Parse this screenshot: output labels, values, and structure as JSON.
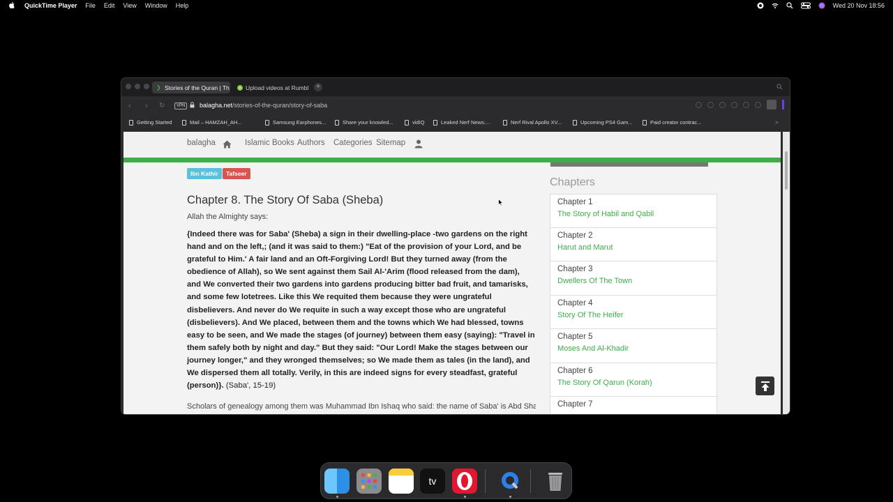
{
  "menubar": {
    "app_name": "QuickTime Player",
    "menus": [
      "File",
      "Edit",
      "View",
      "Window",
      "Help"
    ],
    "datetime": "Wed 20 Nov  18:56"
  },
  "browser": {
    "tabs": [
      {
        "title": "Stories of the Quran | Th",
        "active": true
      },
      {
        "title": "Upload videos at Rumble",
        "active": false
      }
    ],
    "url_domain": "balagha.net",
    "url_path": "/stories-of-the-quran/story-of-saba",
    "vpn_label": "VPN",
    "bookmarks": [
      "Getting Started",
      "Mail – HAMZAH_AH...",
      "Samsung Earphones...",
      "Share your knowled...",
      "vidIQ",
      "Leaked Nerf News:...",
      "Nerf Rival Apollo XV...",
      "Upcoming PS4 Gam...",
      "Paid creator contrac..."
    ]
  },
  "site": {
    "nav": {
      "brand": "balagha",
      "books": "Islamic Books",
      "authors": "Authors",
      "categories": "Categories",
      "sitemap": "Sitemap"
    },
    "tags": [
      "Ibn Kathir",
      "Tafseer"
    ],
    "chapter_title": "Chapter 8. The Story Of Saba (Sheba)",
    "intro": "Allah the Almighty says:",
    "verse_text": "{Indeed there was for Saba' (Sheba) a sign in their dwelling-place -two gardens on the right hand and on the left,; (and it was said to them:) \"Eat of the provision of your Lord, and be grateful to Him.' A fair land and an Oft-Forgiving Lord! But they turned away (from the obedience of Allah), so We sent against them Sail Al-'Arim (flood released from the dam), and We converted their two gardens into gardens producing bitter bad fruit, and tamarisks, and some few lotetrees. Like this We requited them because they were ungrateful disbelievers. And never do We requite in such a way except those who are ungrateful (disbelievers). And We placed, between them and the towns which We had blessed, towns easy to be seen, and We made the stages (of journey) between them easy (saying): \"Travel in them safely both by night and day.\" But they said: \"Our Lord! Make the stages between our journey longer,\" and they wronged themselves; so We made them as tales (in the land), and We dispersed them all totally. Verily, in this are indeed signs for every steadfast, grateful (person)}.",
    "verse_ref": "(Saba', 15-19)",
    "paragraph": "Scholars of genealogy among them was Muhammad Ibn Ishaq who said: the name of Saba' is Abd Shams Ibn Yashjub Ibn",
    "chapters_heading": "Chapters",
    "chapters": [
      {
        "number": "Chapter 1",
        "title": "The Story of Habil and Qabil"
      },
      {
        "number": "Chapter 2",
        "title": "Harut and Marut"
      },
      {
        "number": "Chapter 3",
        "title": "Dwellers Of The Town"
      },
      {
        "number": "Chapter 4",
        "title": "Story Of The Heifer"
      },
      {
        "number": "Chapter 5",
        "title": "Moses And Al-Khadir"
      },
      {
        "number": "Chapter 6",
        "title": "The Story Of Qarun (Korah)"
      },
      {
        "number": "Chapter 7",
        "title": ""
      }
    ]
  },
  "colors": {
    "accent_green": "#3fae49",
    "tag_blue": "#5bc0de",
    "tag_red": "#d9534f"
  },
  "dock": [
    "Finder",
    "Launchpad",
    "Notes",
    "TV",
    "Opera",
    "QuickTime Player",
    "Trash"
  ]
}
